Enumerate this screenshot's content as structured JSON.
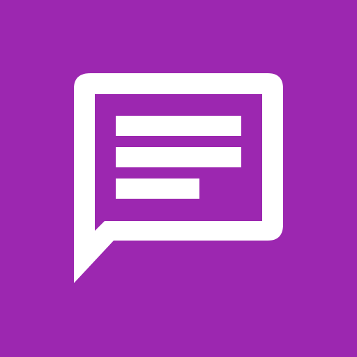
{
  "app_icon": {
    "icon": "message-bubble-icon",
    "background_color": "#9C27B0",
    "foreground_color": "#FFFFFF"
  }
}
